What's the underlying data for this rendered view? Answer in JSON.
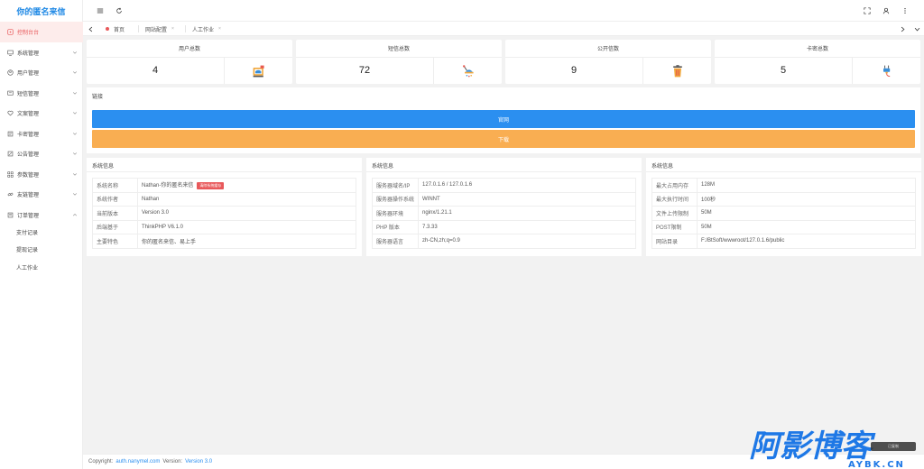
{
  "sidebar": {
    "logo": "你的匿名来信",
    "items": [
      {
        "label": "控制台台",
        "icon": "dashboard-icon"
      },
      {
        "label": "系统管理",
        "icon": "monitor-icon"
      },
      {
        "label": "用户管理",
        "icon": "user-icon"
      },
      {
        "label": "短信管理",
        "icon": "message-icon"
      },
      {
        "label": "文案管理",
        "icon": "heart-icon"
      },
      {
        "label": "卡密管理",
        "icon": "card-icon"
      },
      {
        "label": "公告管理",
        "icon": "edit-icon"
      },
      {
        "label": "参数管理",
        "icon": "grid-icon"
      },
      {
        "label": "友链管理",
        "icon": "link-icon"
      },
      {
        "label": "订单管理",
        "icon": "order-icon"
      }
    ],
    "sub_items": [
      "支付记录",
      "提现记录",
      "人工作业"
    ]
  },
  "tabs": {
    "items": [
      {
        "label": "首页",
        "closable": false
      },
      {
        "label": "网站配置",
        "closable": true
      },
      {
        "label": "人工作业",
        "closable": true
      }
    ],
    "close_symbol": "×"
  },
  "stats": [
    {
      "label": "用户总数",
      "value": "4",
      "icon": "cup-icon"
    },
    {
      "label": "短信总数",
      "value": "72",
      "icon": "lamp-icon"
    },
    {
      "label": "公开信数",
      "value": "9",
      "icon": "trash-icon"
    },
    {
      "label": "卡密总数",
      "value": "5",
      "icon": "plug-icon"
    }
  ],
  "links": {
    "title": "链接",
    "primary": "官网",
    "secondary": "下载"
  },
  "panels": [
    {
      "title": "系统信息",
      "rows": [
        {
          "k": "系统名称",
          "v": "Nathan-你的匿名来信",
          "badge": "清除系统缓存"
        },
        {
          "k": "系统作者",
          "v": "Nathan"
        },
        {
          "k": "当前版本",
          "v": "Version 3.0"
        },
        {
          "k": "后端基于",
          "v": "ThinkPHP V6.1.0"
        },
        {
          "k": "主要特色",
          "v": "你的匿名来信、易上手"
        }
      ]
    },
    {
      "title": "系统信息",
      "rows": [
        {
          "k": "服务器域名/IP",
          "v": "127.0.1.6 / 127.0.1.6"
        },
        {
          "k": "服务器操作系统",
          "v": "WINNT"
        },
        {
          "k": "服务器环境",
          "v": "nginx/1.21.1"
        },
        {
          "k": "PHP 版本",
          "v": "7.3.33"
        },
        {
          "k": "服务器语言",
          "v": "zh-CN,zh;q=0.9"
        }
      ]
    },
    {
      "title": "系统信息",
      "rows": [
        {
          "k": "最大占用内存",
          "v": "128M"
        },
        {
          "k": "最大执行时间",
          "v": "100秒"
        },
        {
          "k": "文件上传限制",
          "v": "50M"
        },
        {
          "k": "POST限制",
          "v": "50M"
        },
        {
          "k": "网站目录",
          "v": "F:/BtSoft/wwwroot/127.0.1.6/public"
        }
      ]
    }
  ],
  "footer": {
    "prefix": "Copyright:",
    "link": "auth.nanymel.com",
    "version_label": "Version:",
    "version": "Version 3.0"
  },
  "watermark": {
    "text": "阿影博客",
    "url": "AYBK.CN",
    "toast": "已复制"
  },
  "colors": {
    "accent": "#1e88e5",
    "active": "#e8585a",
    "primary_button": "#2b8ff0",
    "secondary_button": "#f9ae52"
  }
}
